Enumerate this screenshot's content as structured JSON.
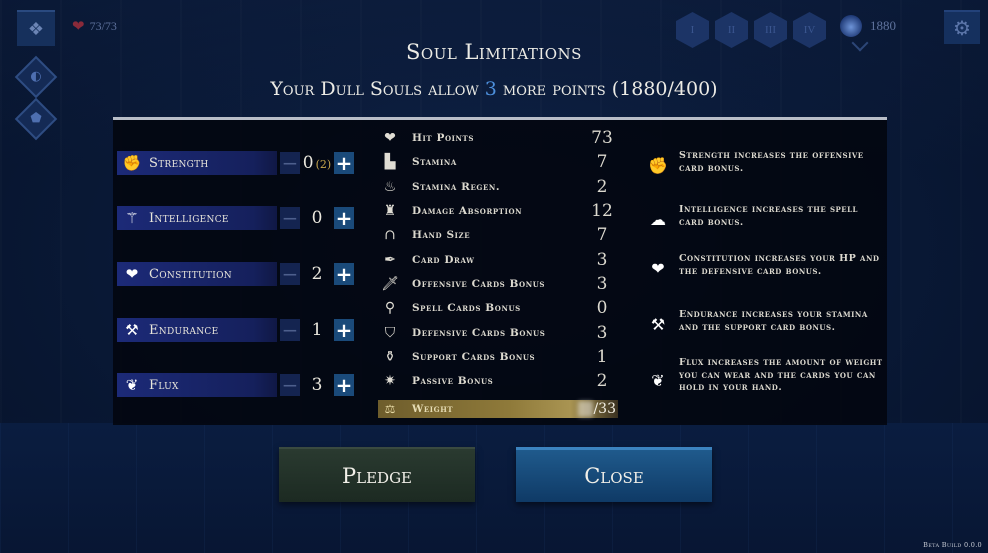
{
  "hud": {
    "menu_icon": "cards-icon",
    "hp": "73/73",
    "hp_icon": "heart-icon",
    "side_icons": [
      "map-icon",
      "shield-icon"
    ],
    "levels": [
      "I",
      "II",
      "III",
      "IV"
    ],
    "souls": "1880",
    "settings_icon": "gear-icon"
  },
  "dialog": {
    "title": "Soul Limitations",
    "subtitle_pre": "Your Dull Souls allow ",
    "subtitle_points": "3",
    "subtitle_post": " more points (1880/400)",
    "accent_color": "#4d8fdc"
  },
  "attributes": [
    {
      "name": "Strength",
      "icon": "fist-icon",
      "value": "0",
      "bonus": "(2)"
    },
    {
      "name": "Intelligence",
      "icon": "staff-icon",
      "value": "0",
      "bonus": ""
    },
    {
      "name": "Constitution",
      "icon": "heart-icon",
      "value": "2",
      "bonus": ""
    },
    {
      "name": "Endurance",
      "icon": "anvil-icon",
      "value": "1",
      "bonus": ""
    },
    {
      "name": "Flux",
      "icon": "feather-icon",
      "value": "3",
      "bonus": ""
    }
  ],
  "attr_controls": {
    "minus": "−",
    "plus": "+"
  },
  "stats": [
    {
      "name": "Hit Points",
      "icon": "heart-icon",
      "value": "73"
    },
    {
      "name": "Stamina",
      "icon": "boot-icon",
      "value": "7"
    },
    {
      "name": "Stamina Regen.",
      "icon": "flame-icon",
      "value": "2"
    },
    {
      "name": "Damage Absorption",
      "icon": "armor-icon",
      "value": "12"
    },
    {
      "name": "Hand Size",
      "icon": "hood-icon",
      "value": "7"
    },
    {
      "name": "Card Draw",
      "icon": "quill-icon",
      "value": "3"
    },
    {
      "name": "Offensive Cards Bonus",
      "icon": "sword-icon",
      "value": "3"
    },
    {
      "name": "Spell Cards Bonus",
      "icon": "wand-icon",
      "value": "0"
    },
    {
      "name": "Defensive Cards Bonus",
      "icon": "shield-icon",
      "value": "3"
    },
    {
      "name": "Support Cards Bonus",
      "icon": "potion-icon",
      "value": "1"
    },
    {
      "name": "Passive Bonus",
      "icon": "star-burst-icon",
      "value": "2"
    }
  ],
  "weight": {
    "name": "Weight",
    "icon": "scales-icon",
    "current": "??",
    "max": "/33"
  },
  "descriptions": [
    {
      "icon": "fist-icon",
      "text": "Strength increases the offensive card bonus."
    },
    {
      "icon": "brain-icon",
      "text": "Intelligence increases the spell card bonus."
    },
    {
      "icon": "heart-icon",
      "text": "Constitution increases your HP and the defensive card bonus."
    },
    {
      "icon": "anvil-icon",
      "text": "Endurance increases your stamina and the support card bonus."
    },
    {
      "icon": "feather-icon",
      "text": "Flux increases the amount of weight you can wear and the cards you can hold in your hand."
    }
  ],
  "buttons": {
    "pledge": "Pledge",
    "close": "Close"
  },
  "footer": {
    "build": "Beta Build 0.0.0"
  }
}
